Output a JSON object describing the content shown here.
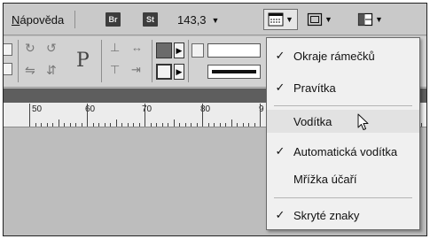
{
  "menubar": {
    "help_label": "Nápověda",
    "help_mnemonic": "N",
    "help_rest": "ápověda",
    "bridge_label": "Br",
    "stock_label": "St",
    "zoom_value": "143,3",
    "zoom_caret": "▼"
  },
  "toolbar_icons": [
    "view-options-icon",
    "screen-mode-icon",
    "arrange-documents-icon"
  ],
  "control_panel": {
    "proxy_letter": "P"
  },
  "ruler": {
    "labels": [
      "50",
      "60",
      "70",
      "80",
      "9"
    ]
  },
  "view_menu": {
    "items": [
      {
        "label": "Okraje rámečků",
        "checked": true,
        "check": "✓"
      },
      {
        "label": "Pravítka",
        "checked": true,
        "check": "✓"
      },
      {
        "label": "Vodítka",
        "checked": false,
        "check": "",
        "hovered": true
      },
      {
        "label": "Automatická vodítka",
        "checked": true,
        "check": "✓"
      },
      {
        "label": "Mřížka účaří",
        "checked": false,
        "check": ""
      },
      {
        "label": "Skryté znaky",
        "checked": true,
        "check": "✓"
      }
    ]
  },
  "colors": {
    "menubar_bg": "#c9c9c9",
    "menu_bg": "#f0f0f0",
    "band": "#5e5e5e",
    "badge": "#3d3d3d"
  }
}
